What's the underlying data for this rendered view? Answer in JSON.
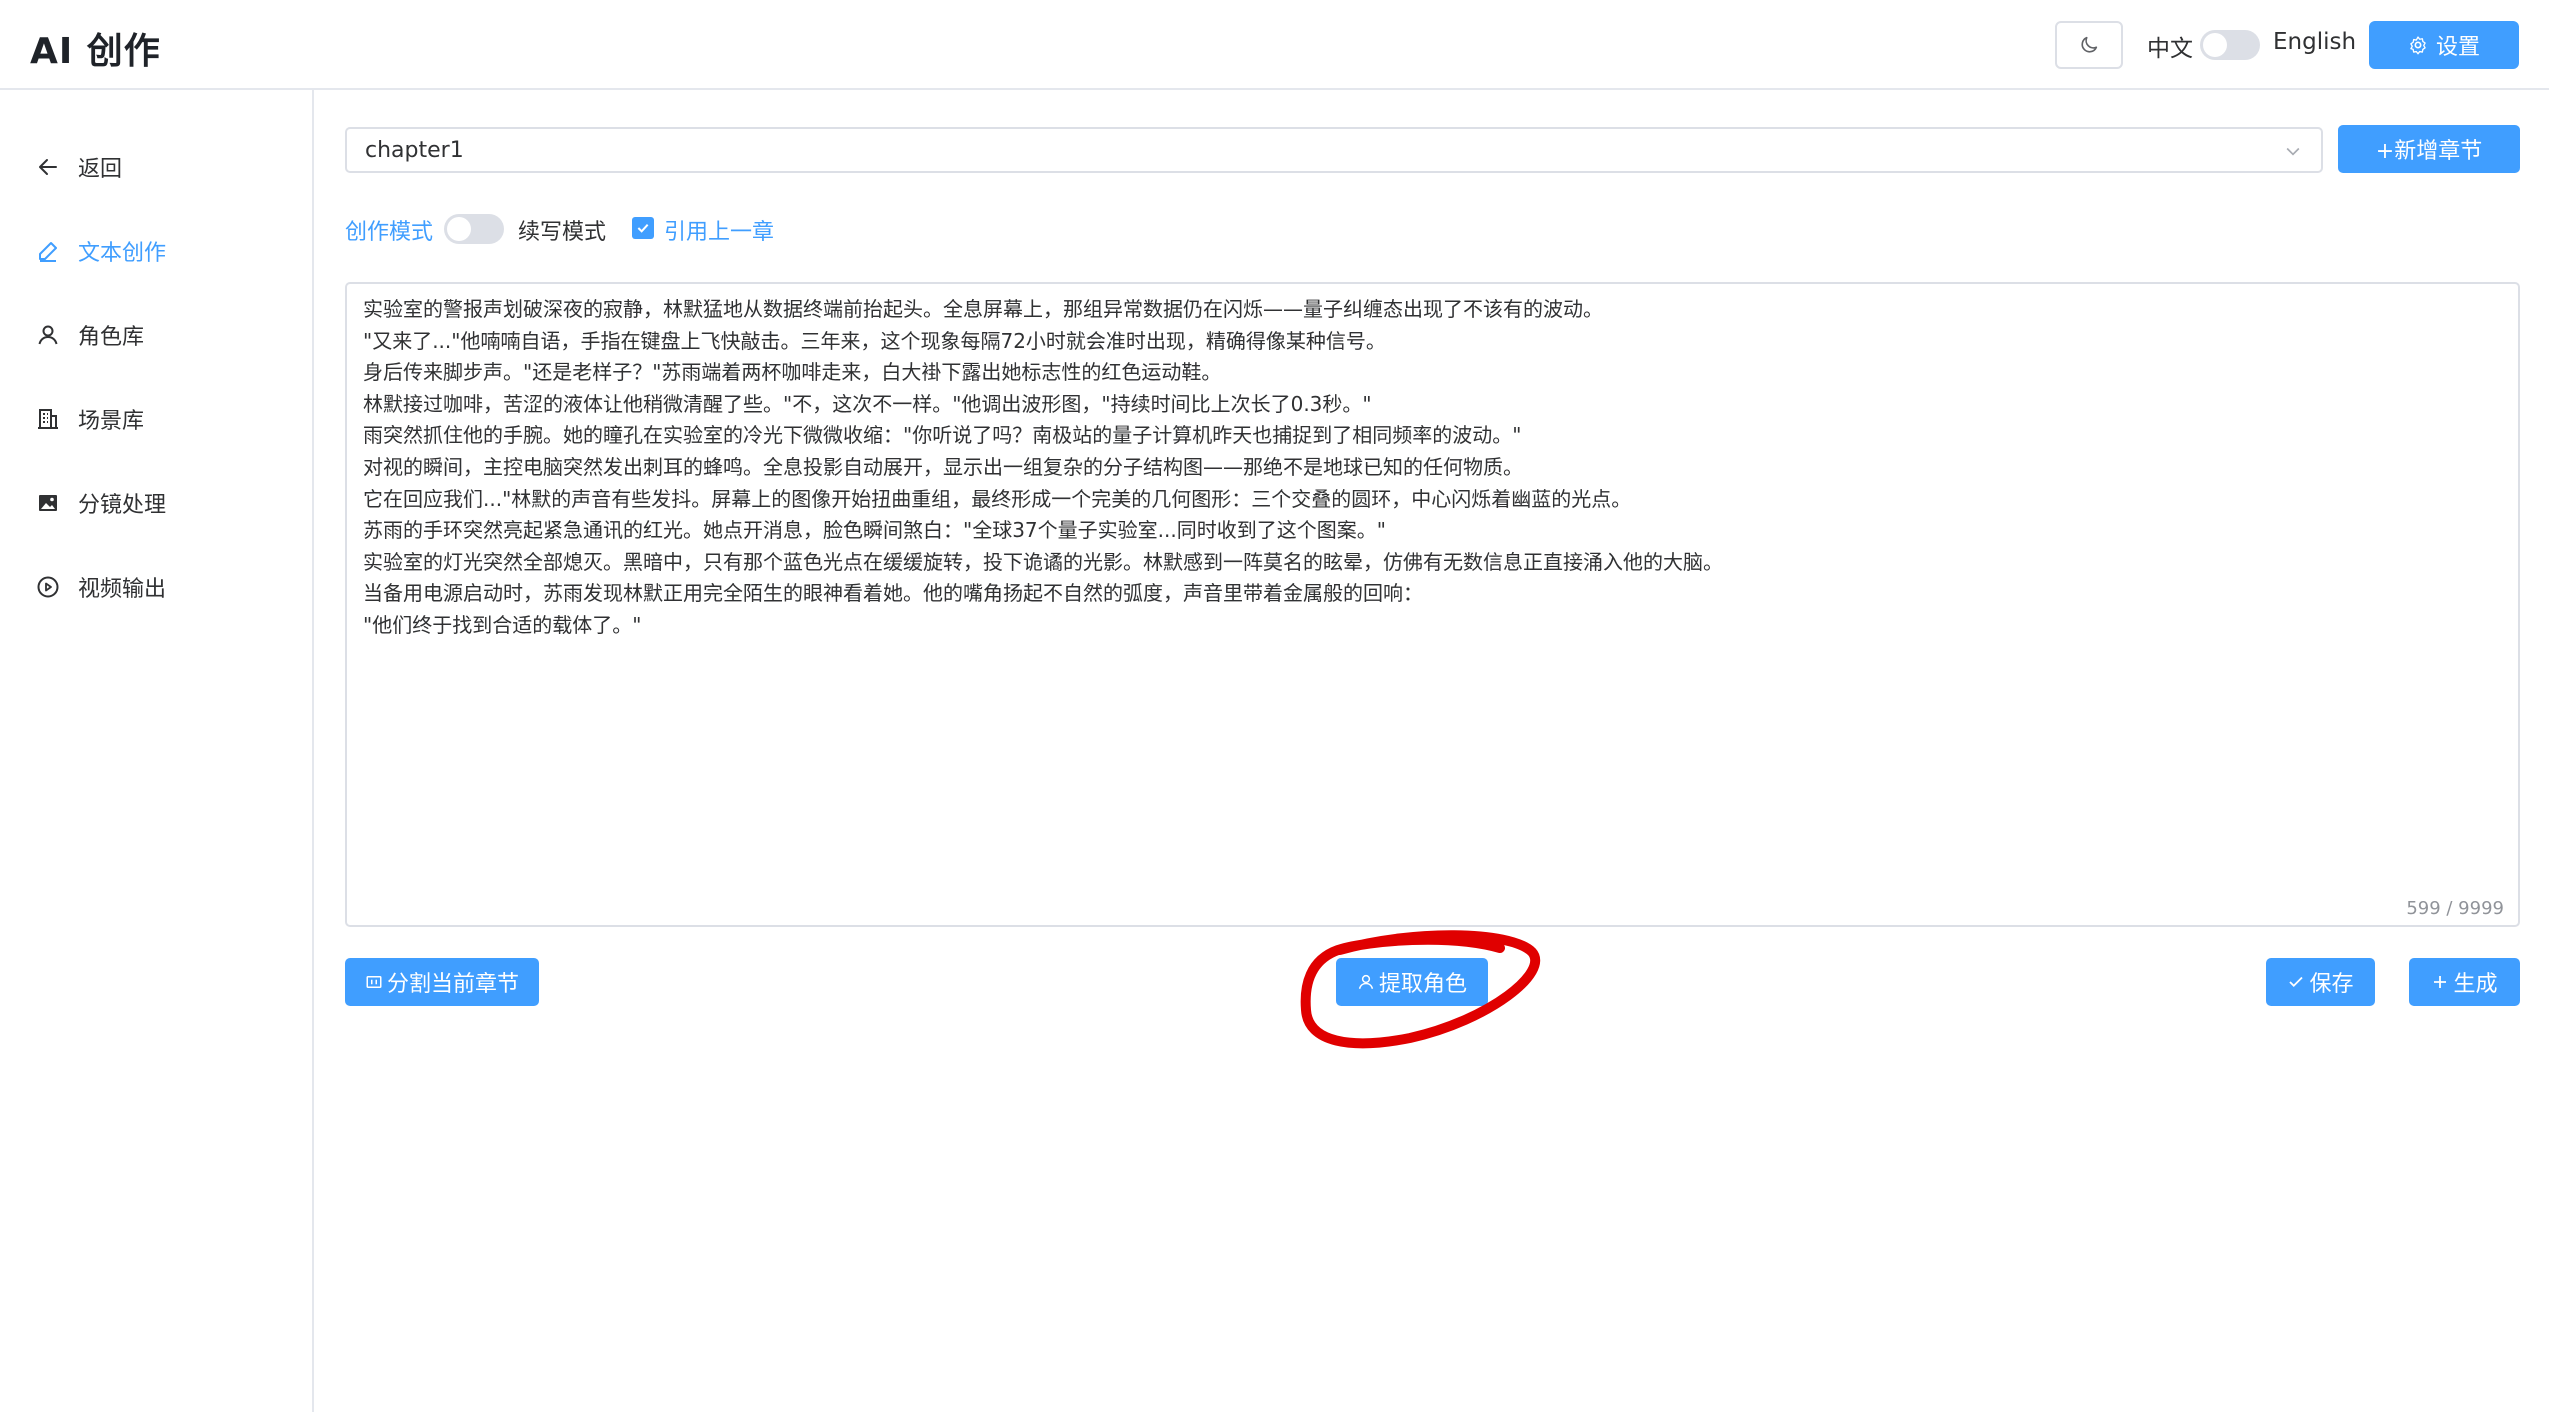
{
  "header": {
    "title": "AI 创作",
    "theme_icon": "moon-icon",
    "lang_zh": "中文",
    "lang_en": "English",
    "settings_label": "设置",
    "settings_icon": "gear-icon"
  },
  "sidebar": {
    "items": [
      {
        "label": "返回",
        "icon": "arrow-left-icon",
        "active": false
      },
      {
        "label": "文本创作",
        "icon": "edit-icon",
        "active": true
      },
      {
        "label": "角色库",
        "icon": "user-icon",
        "active": false
      },
      {
        "label": "场景库",
        "icon": "building-icon",
        "active": false
      },
      {
        "label": "分镜处理",
        "icon": "image-icon",
        "active": false
      },
      {
        "label": "视频输出",
        "icon": "play-circle-icon",
        "active": false
      }
    ]
  },
  "main": {
    "chapter_select_value": "chapter1",
    "new_chapter_label": "+新增章节",
    "mode_left_label": "创作模式",
    "mode_right_label": "续写模式",
    "reference_checked": true,
    "reference_label": "引用上一章",
    "editor_lines": [
      "实验室的警报声划破深夜的寂静，林默猛地从数据终端前抬起头。全息屏幕上，那组异常数据仍在闪烁——量子纠缠态出现了不该有的波动。",
      "\"又来了...\"他喃喃自语，手指在键盘上飞快敲击。三年来，这个现象每隔72小时就会准时出现，精确得像某种信号。",
      "身后传来脚步声。\"还是老样子？\"苏雨端着两杯咖啡走来，白大褂下露出她标志性的红色运动鞋。",
      "林默接过咖啡，苦涩的液体让他稍微清醒了些。\"不，这次不一样。\"他调出波形图，\"持续时间比上次长了0.3秒。\"",
      "雨突然抓住他的手腕。她的瞳孔在实验室的冷光下微微收缩：\"你听说了吗？南极站的量子计算机昨天也捕捉到了相同频率的波动。\"",
      "对视的瞬间，主控电脑突然发出刺耳的蜂鸣。全息投影自动展开，显示出一组复杂的分子结构图——那绝不是地球已知的任何物质。",
      "它在回应我们...\"林默的声音有些发抖。屏幕上的图像开始扭曲重组，最终形成一个完美的几何图形：三个交叠的圆环，中心闪烁着幽蓝的光点。",
      "苏雨的手环突然亮起紧急通讯的红光。她点开消息，脸色瞬间煞白：\"全球37个量子实验室...同时收到了这个图案。\"",
      "实验室的灯光突然全部熄灭。黑暗中，只有那个蓝色光点在缓缓旋转，投下诡谲的光影。林默感到一阵莫名的眩晕，仿佛有无数信息正直接涌入他的大脑。",
      "当备用电源启动时，苏雨发现林默正用完全陌生的眼神看着她。他的嘴角扬起不自然的弧度，声音里带着金属般的回响：",
      "\"他们终于找到合适的载体了。\""
    ],
    "word_count": "599 / 9999",
    "split_label": "分割当前章节",
    "extract_label": "提取角色",
    "save_label": "保存",
    "generate_label": "生成"
  },
  "colors": {
    "primary": "#409eff",
    "annotation": "#e00000"
  }
}
